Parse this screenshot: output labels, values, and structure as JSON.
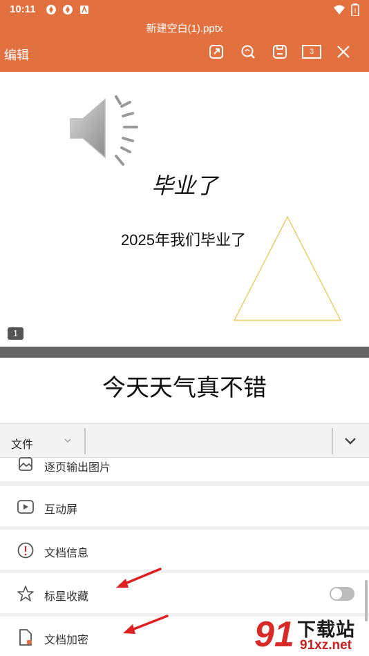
{
  "status_bar": {
    "time": "10:11"
  },
  "header": {
    "document_title": "新建空白(1).pptx",
    "edit_label": "编辑",
    "page_count": "3"
  },
  "slides": [
    {
      "number": "1",
      "title": "毕业了",
      "subtitle": "2025年我们毕业了"
    },
    {
      "text": "今天天气真不错"
    }
  ],
  "toolbar": {
    "tab_label": "文件"
  },
  "menu": {
    "items": [
      {
        "label": "逐页输出图片",
        "icon": "image-export-icon"
      },
      {
        "label": "互动屏",
        "icon": "screen-cast-icon"
      },
      {
        "label": "文档信息",
        "icon": "info-icon"
      },
      {
        "label": "标星收藏",
        "icon": "star-icon",
        "toggle": false
      },
      {
        "label": "文档加密",
        "icon": "lock-document-icon"
      }
    ]
  },
  "watermark": {
    "number_text": "91",
    "cn_text": "下载站",
    "domain_text": "91xz.net"
  },
  "colors": {
    "header_bg": "#e3703f",
    "arrow_red": "#e02020",
    "triangle_stroke": "#f0c040"
  }
}
